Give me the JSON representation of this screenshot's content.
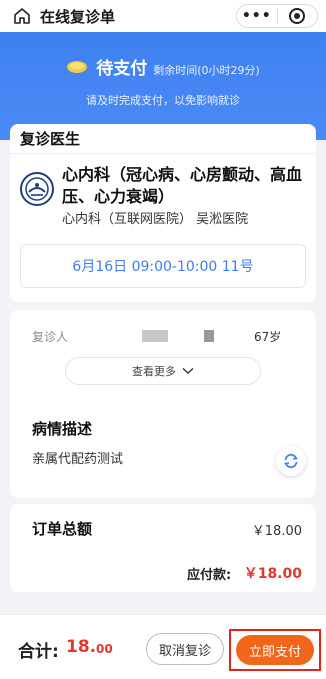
{
  "nav": {
    "title": "在线复诊单",
    "menu_glyph": "•••"
  },
  "status": {
    "label": "待支付",
    "remaining": "剩余时间(0小时29分)",
    "hint": "请及时完成支付，以免影响就诊"
  },
  "doctor_section": {
    "heading": "复诊医生",
    "department_title": "心内科（冠心病、心房颤动、高血压、心力衰竭）",
    "department_sub": "心内科（互联网医院） 吴淞医院",
    "appointment_time": "6月16日 09:00-10:00 11号"
  },
  "patient": {
    "label": "复诊人",
    "age": "67岁",
    "more_button": "查看更多",
    "desc_title": "病情描述",
    "desc_text": "亲属代配药测试"
  },
  "order": {
    "title": "订单总额",
    "amount": "￥18.00",
    "payable_label": "应付款:",
    "payable_amount": "￥18.00"
  },
  "bottom": {
    "total_label": "合计:",
    "total_value": "18.",
    "total_cents": "00",
    "cancel_button": "取消复诊",
    "pay_button": "立即支付"
  },
  "colors": {
    "primary_blue": "#3f80f0",
    "price_red": "#e4382b",
    "pay_orange": "#f2661a"
  },
  "icons": {
    "home": "home-icon",
    "target": "target-icon",
    "coin": "coin-icon",
    "hospital_logo": "hospital-logo-icon",
    "chevron": "chevron-down-icon",
    "refresh": "refresh-icon"
  }
}
